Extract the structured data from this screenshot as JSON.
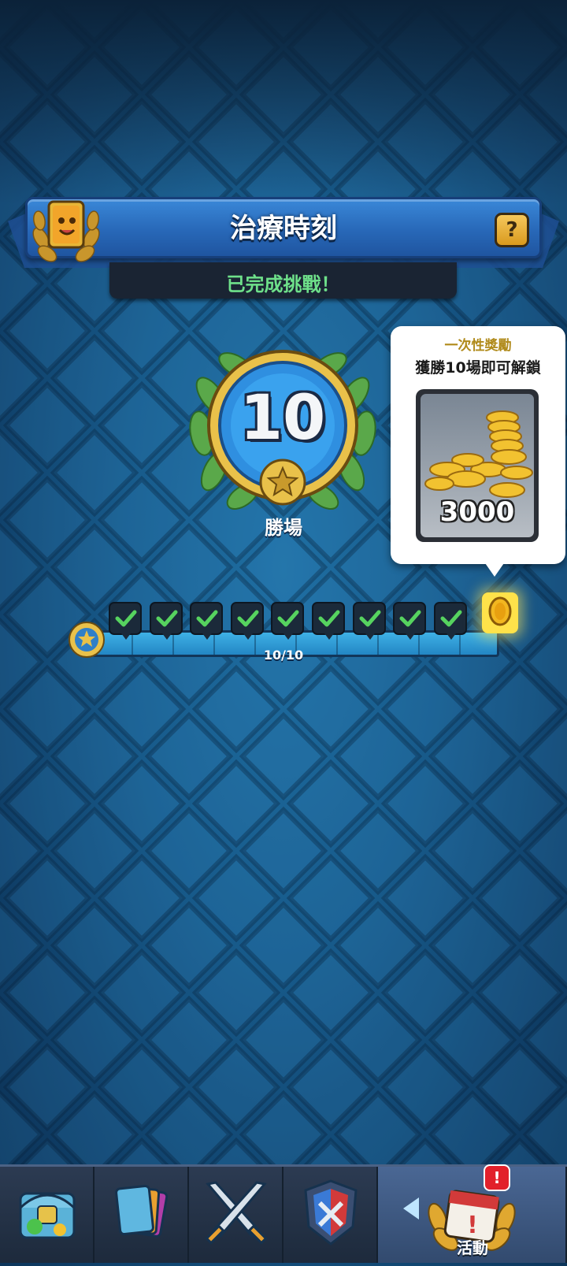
{
  "event": {
    "title": "治療時刻",
    "help_label": "?",
    "status": "已完成挑戰！"
  },
  "badge": {
    "wins": "10",
    "label": "勝場"
  },
  "reward": {
    "heading": "一次性獎勵",
    "condition": "獲勝10場即可解鎖",
    "gold_amount": "3000"
  },
  "progress": {
    "text": "10/10",
    "completed": 10,
    "total": 10
  },
  "nav": {
    "tabs": [
      {
        "name": "shop-tab",
        "icon": "chest-icon"
      },
      {
        "name": "cards-tab",
        "icon": "cards-icon"
      },
      {
        "name": "battle-tab",
        "icon": "crossed-swords-icon"
      },
      {
        "name": "clan-tab",
        "icon": "clan-shield-icon"
      },
      {
        "name": "events-tab",
        "icon": "calendar-icon",
        "label": "活動",
        "badge": "!"
      }
    ]
  },
  "colors": {
    "accent": "#2868b8",
    "success": "#6ee08a",
    "gold": "#f2c230"
  }
}
